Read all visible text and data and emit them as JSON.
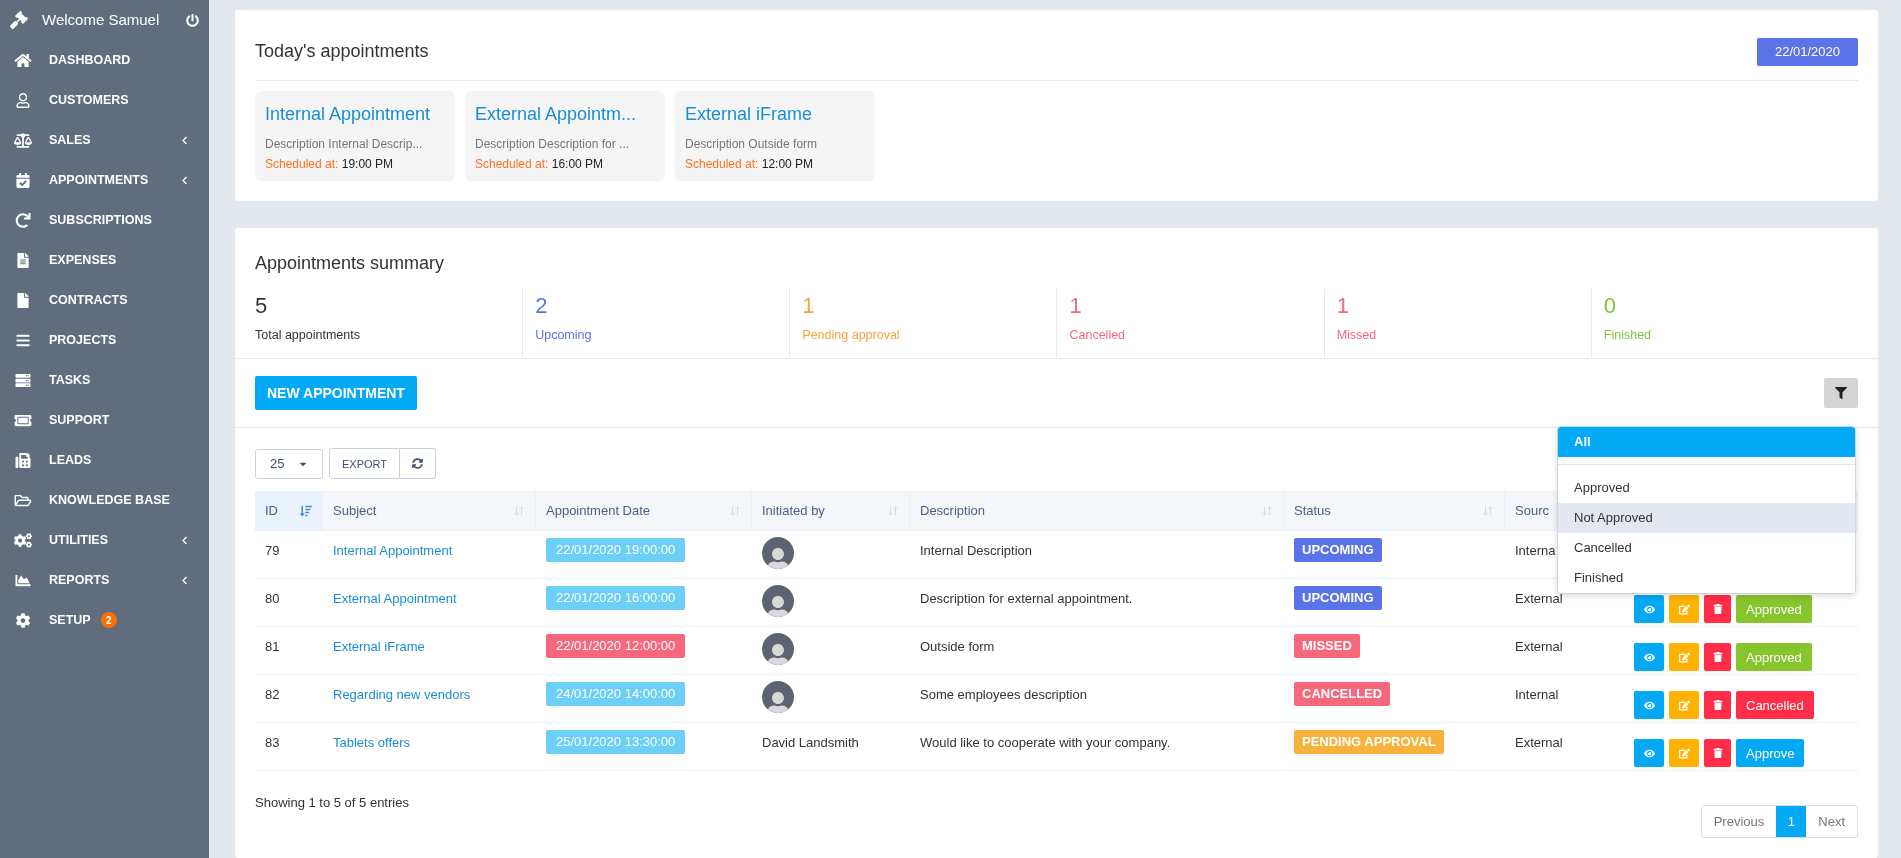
{
  "sidebar": {
    "welcome": "Welcome Samuel",
    "items": [
      {
        "label": "DASHBOARD",
        "submenu": false
      },
      {
        "label": "CUSTOMERS",
        "submenu": false
      },
      {
        "label": "SALES",
        "submenu": true
      },
      {
        "label": "APPOINTMENTS",
        "submenu": true
      },
      {
        "label": "SUBSCRIPTIONS",
        "submenu": false
      },
      {
        "label": "EXPENSES",
        "submenu": false
      },
      {
        "label": "CONTRACTS",
        "submenu": false
      },
      {
        "label": "PROJECTS",
        "submenu": false
      },
      {
        "label": "TASKS",
        "submenu": false
      },
      {
        "label": "SUPPORT",
        "submenu": false
      },
      {
        "label": "LEADS",
        "submenu": false
      },
      {
        "label": "KNOWLEDGE BASE",
        "submenu": false
      },
      {
        "label": "UTILITIES",
        "submenu": true
      },
      {
        "label": "REPORTS",
        "submenu": true
      },
      {
        "label": "SETUP",
        "submenu": false,
        "badge": "2"
      }
    ]
  },
  "today": {
    "title": "Today's appointments",
    "date": "22/01/2020",
    "cards": [
      {
        "title": "Internal Appointment",
        "description": "Description Internal Descrip...",
        "scheduled_label": "Scheduled at:",
        "time": "19:00 PM"
      },
      {
        "title": "External Appointm...",
        "description": "Description Description for ...",
        "scheduled_label": "Scheduled at:",
        "time": "16:00 PM"
      },
      {
        "title": "External iFrame",
        "description": "Description Outside form",
        "scheduled_label": "Scheduled at:",
        "time": "12:00 PM"
      }
    ]
  },
  "summary": {
    "title": "Appointments summary",
    "stats": [
      {
        "value": "5",
        "label": "Total appointments",
        "color": "#333333"
      },
      {
        "value": "2",
        "label": "Upcoming",
        "color": "#5b73e8"
      },
      {
        "value": "1",
        "label": "Pending approval",
        "color": "#f7a33b"
      },
      {
        "value": "1",
        "label": "Cancelled",
        "color": "#f7687f"
      },
      {
        "value": "1",
        "label": "Missed",
        "color": "#f7687f"
      },
      {
        "value": "0",
        "label": "Finished",
        "color": "#7cc63a"
      }
    ],
    "new_button": "NEW APPOINTMENT",
    "per_page": "25",
    "export": "EXPORT",
    "columns": [
      {
        "label": "ID",
        "sorted": true
      },
      {
        "label": "Subject",
        "sorted": false
      },
      {
        "label": "Appointment Date",
        "sorted": false
      },
      {
        "label": "Initiated by",
        "sorted": false
      },
      {
        "label": "Description",
        "sorted": false
      },
      {
        "label": "Status",
        "sorted": false
      },
      {
        "label": "Sourc"
      }
    ],
    "rows": [
      {
        "id": "79",
        "subject": "Internal Appointment",
        "date": "22/01/2020 19:00:00",
        "late": false,
        "initiator": {
          "kind": "avatar"
        },
        "description": "Internal Description",
        "status": {
          "label": "UPCOMING",
          "kind": "upcoming"
        },
        "source": "Interna"
      },
      {
        "id": "80",
        "subject": "External Appointment",
        "date": "22/01/2020 16:00:00",
        "late": false,
        "initiator": {
          "kind": "avatar"
        },
        "description": "Description for external appointment.",
        "status": {
          "label": "UPCOMING",
          "kind": "upcoming"
        },
        "source": "External",
        "approval": {
          "label": "Approved",
          "kind": "approved"
        }
      },
      {
        "id": "81",
        "subject": "External iFrame",
        "date": "22/01/2020 12:00:00",
        "late": true,
        "initiator": {
          "kind": "avatar"
        },
        "description": "Outside form",
        "status": {
          "label": "MISSED",
          "kind": "missed"
        },
        "source": "External",
        "approval": {
          "label": "Approved",
          "kind": "approved"
        }
      },
      {
        "id": "82",
        "subject": "Regarding new vendors",
        "date": "24/01/2020 14:00:00",
        "late": false,
        "initiator": {
          "kind": "avatar"
        },
        "description": "Some employees description",
        "status": {
          "label": "CANCELLED",
          "kind": "cancelled"
        },
        "source": "Internal",
        "approval": {
          "label": "Cancelled",
          "kind": "cancelled"
        }
      },
      {
        "id": "83",
        "subject": "Tablets offers",
        "date": "25/01/2020 13:30:00",
        "late": false,
        "initiator": {
          "kind": "text",
          "name": "David Landsmith"
        },
        "description": "Would like to cooperate with your company.",
        "status": {
          "label": "PENDING APPROVAL",
          "kind": "pending"
        },
        "source": "External",
        "approval": {
          "label": "Approve",
          "kind": "approve"
        }
      }
    ],
    "info": "Showing 1 to 5 of 5 entries",
    "pagination": {
      "previous": "Previous",
      "pages": [
        {
          "label": "1",
          "selected": true
        }
      ],
      "next": "Next"
    }
  },
  "filter_menu": {
    "items": [
      {
        "label": "All",
        "selected": true,
        "highlighted": false
      },
      {
        "label": "Approved",
        "selected": false,
        "highlighted": false
      },
      {
        "label": "Not Approved",
        "selected": false,
        "highlighted": true
      },
      {
        "label": "Cancelled",
        "selected": false,
        "highlighted": false
      },
      {
        "label": "Finished",
        "selected": false,
        "highlighted": false
      }
    ]
  }
}
